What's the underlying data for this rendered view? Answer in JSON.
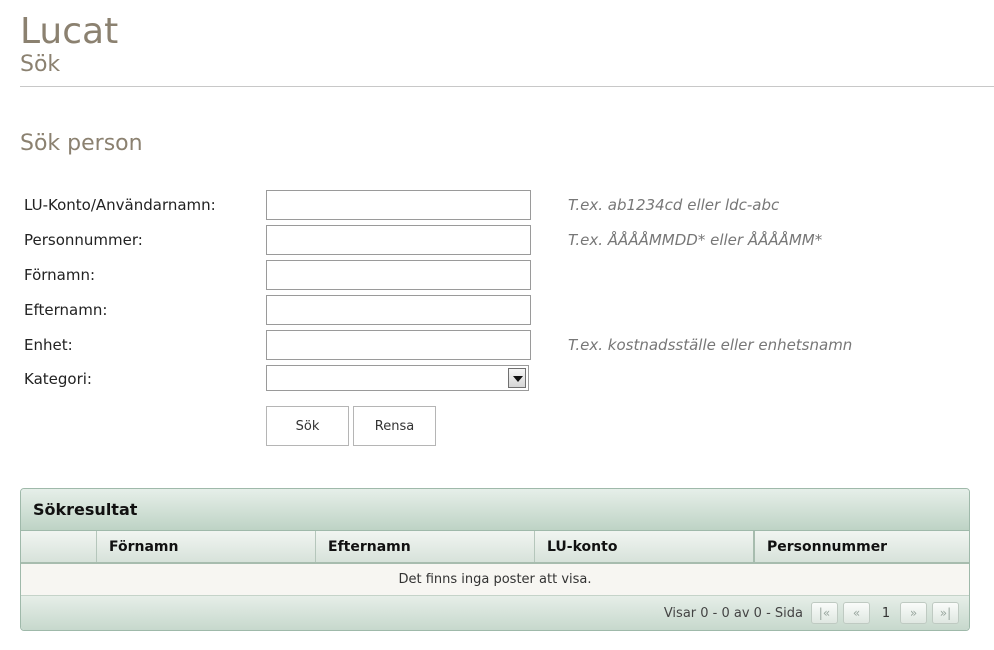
{
  "header": {
    "title": "Lucat",
    "subtitle": "Sök"
  },
  "search": {
    "section_title": "Sök person",
    "fields": [
      {
        "label": "LU-Konto/Användarnamn:",
        "value": "",
        "hint": "T.ex. ab1234cd eller ldc-abc"
      },
      {
        "label": "Personnummer:",
        "value": "",
        "hint": "T.ex. ÅÅÅÅMMDD* eller ÅÅÅÅMM*"
      },
      {
        "label": "Förnamn:",
        "value": "",
        "hint": ""
      },
      {
        "label": "Efternamn:",
        "value": "",
        "hint": ""
      },
      {
        "label": "Enhet:",
        "value": "",
        "hint": "T.ex. kostnadsställe eller enhetsnamn"
      }
    ],
    "category": {
      "label": "Kategori:",
      "selected": ""
    },
    "buttons": {
      "search": "Sök",
      "reset": "Rensa"
    }
  },
  "results": {
    "title": "Sökresultat",
    "columns": [
      "",
      "Förnamn",
      "Efternamn",
      "LU-konto",
      "Personnummer"
    ],
    "empty_message": "Det finns inga poster att visa.",
    "pager": {
      "summary": "Visar 0 - 0 av 0 - Sida",
      "current_page": "1",
      "first_icon": "first-page-icon",
      "prev_icon": "previous-page-icon",
      "next_icon": "next-page-icon",
      "last_icon": "last-page-icon"
    }
  },
  "colors": {
    "heading": "#8b8170",
    "panel_green": "#bed3c5",
    "border": "#9fb9aa"
  }
}
